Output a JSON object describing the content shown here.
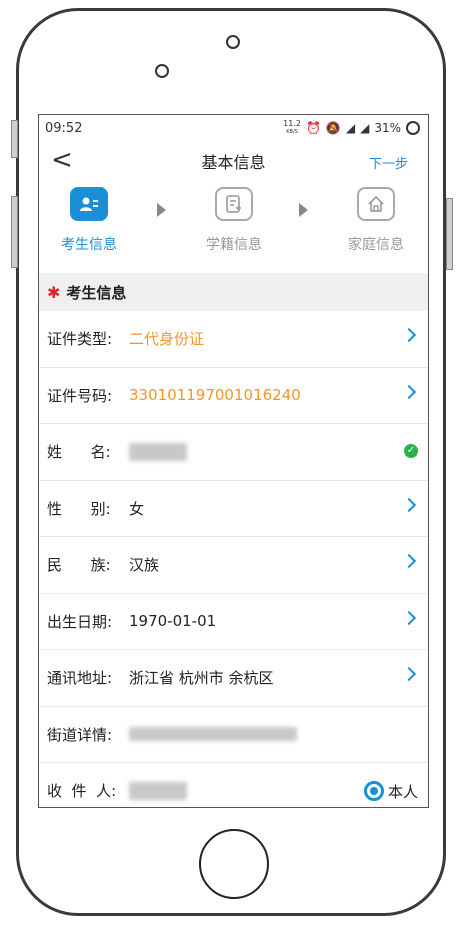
{
  "status": {
    "time": "09:52",
    "net_speed_top": "11.2",
    "net_speed_bottom": "KB/S",
    "battery": "31%"
  },
  "nav": {
    "back": "<",
    "title": "基本信息",
    "next": "下一步"
  },
  "steps": [
    {
      "label": "考生信息",
      "icon": "person-card-icon",
      "active": true
    },
    {
      "label": "学籍信息",
      "icon": "document-edit-icon",
      "active": false
    },
    {
      "label": "家庭信息",
      "icon": "home-icon",
      "active": false
    }
  ],
  "section": {
    "title": "考生信息"
  },
  "rows": {
    "cert_type": {
      "label": "证件类型:",
      "value": "二代身份证"
    },
    "cert_no": {
      "label": "证件号码:",
      "value": "330101197001016240"
    },
    "name": {
      "label": "姓      名:"
    },
    "gender": {
      "label": "性      别:",
      "value": "女"
    },
    "ethnic": {
      "label": "民      族:",
      "value": "汉族"
    },
    "birth": {
      "label": "出生日期:",
      "value": "1970-01-01"
    },
    "address": {
      "label": "通讯地址:",
      "value": "浙江省 杭州市 余杭区"
    },
    "street": {
      "label": "街道详情:"
    },
    "recipient": {
      "label": "收  件  人:",
      "option": "本人"
    }
  },
  "colors": {
    "accent": "#1a8fd6",
    "orange": "#f0982b",
    "required": "#e0262b",
    "verified": "#2bb04b"
  }
}
